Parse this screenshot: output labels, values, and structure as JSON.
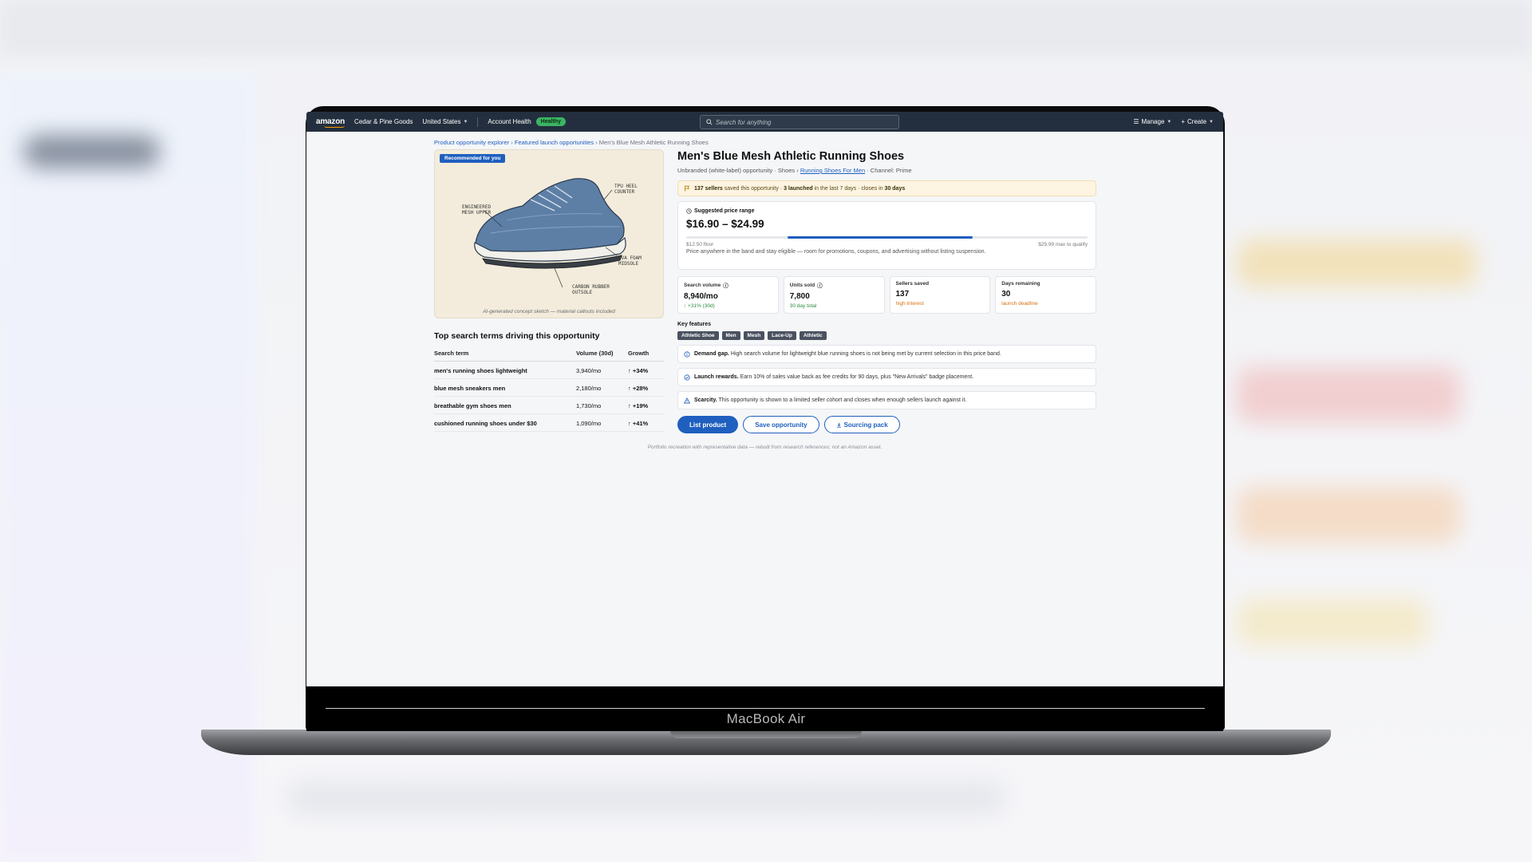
{
  "nav": {
    "logo": "amazon",
    "store_name": "Cedar & Pine Goods",
    "region": "United States",
    "account_health_label": "Account Health",
    "account_health_status": "Healthy",
    "search_placeholder": "Search for anything",
    "manage": "Manage",
    "create": "Create"
  },
  "breadcrumb": {
    "level1": "Product opportunity explorer",
    "sep1": " › ",
    "level2": "Featured launch opportunities",
    "sep2": " › ",
    "current": "Men's Blue Mesh Athletic Running Shoes"
  },
  "image_card": {
    "badge": "Recommended for you",
    "callouts": {
      "heel": "TPU heel counter",
      "upper": "Engineered mesh upper",
      "midsole": "EVA foam midsole",
      "outsole": "Carbon rubber outsole"
    },
    "caption": "AI-generated concept sketch — material callouts included"
  },
  "search_terms": {
    "title": "Top search terms driving this opportunity",
    "headers": [
      "Search term",
      "Volume (30d)",
      "Growth"
    ],
    "rows": [
      {
        "term": "men's running shoes lightweight",
        "volume": "3,940/mo",
        "growth": "↑ +34%"
      },
      {
        "term": "blue mesh sneakers men",
        "volume": "2,180/mo",
        "growth": "↑ +28%"
      },
      {
        "term": "breathable gym shoes men",
        "volume": "1,730/mo",
        "growth": "↑ +19%"
      },
      {
        "term": "cushioned running shoes under $30",
        "volume": "1,090/mo",
        "growth": "↑ +41%"
      }
    ]
  },
  "product": {
    "title": "Men's Blue Mesh Athletic Running Shoes",
    "sub_prefix": "Unbranded (white-label) opportunity · Shoes › ",
    "sub_link": "Running Shoes For Men",
    "sub_suffix": " · Channel: Prime"
  },
  "alert": {
    "sellers_saved": "137 sellers",
    "saved_text": " saved this opportunity · ",
    "launched": "3 launched",
    "launched_text": " in the last 7 days · closes in ",
    "closes": "30 days"
  },
  "price": {
    "label": "Suggested price range",
    "range": "$16.90 – $24.99",
    "floor": "$12.50 floor",
    "max": "$29.99 max to qualify",
    "note": "Price anywhere in the band and stay eligible — room for promotions, coupons, and advertising without listing suspension.",
    "floor_value": 12.5,
    "max_value": 29.99,
    "band_low": 16.9,
    "band_high": 24.99
  },
  "stats": [
    {
      "label": "Search volume",
      "value": "8,940/mo",
      "sub": "↑ +31% (30d)"
    },
    {
      "label": "Units sold",
      "value": "7,800",
      "sub": "30 day total"
    },
    {
      "label": "Sellers saved",
      "value": "137",
      "sub": "high interest"
    },
    {
      "label": "Days remaining",
      "value": "30",
      "sub": "launch deadline"
    }
  ],
  "key_features": {
    "label": "Key features",
    "chips": [
      "Athletic Shoe",
      "Men",
      "Mesh",
      "Lace-Up",
      "Athletic"
    ]
  },
  "info_rows": [
    {
      "title": "Demand gap.",
      "text": " High search volume for lightweight blue running shoes is not being met by current selection in this price band."
    },
    {
      "title": "Launch rewards.",
      "text": " Earn 10% of sales value back as fee credits for 90 days, plus \"New Arrivals\" badge placement."
    },
    {
      "title": "Scarcity.",
      "text": " This opportunity is shown to a limited seller cohort and closes when enough sellers launch against it."
    }
  ],
  "actions": {
    "list": "List product",
    "save": "Save opportunity",
    "sourcing": "Sourcing pack"
  },
  "footer_note": "Portfolio recreation with representative data — rebuilt from research references; not an Amazon asset.",
  "device_label": "MacBook Air",
  "colors": {
    "nav_bg": "#232f3e",
    "accent": "#1f5fbf",
    "healthy": "#3bb562",
    "alert_bg": "#fdf4e1",
    "growth_green": "#2b8a3e",
    "warn_orange": "#d9730d"
  }
}
